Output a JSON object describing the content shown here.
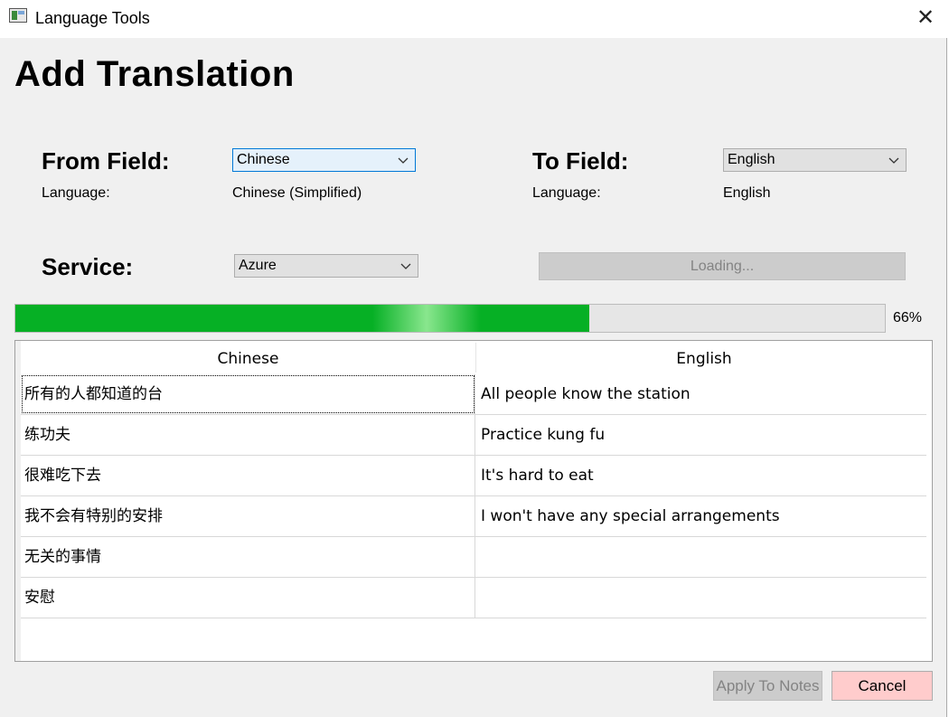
{
  "window": {
    "title": "Language Tools",
    "close_glyph": "✕"
  },
  "dialog": {
    "title": "Add Translation"
  },
  "from": {
    "label": "From Field:",
    "selected": "Chinese",
    "language_label": "Language:",
    "language_value": "Chinese (Simplified)"
  },
  "to": {
    "label": "To Field:",
    "selected": "English",
    "language_label": "Language:",
    "language_value": "English"
  },
  "service": {
    "label": "Service:",
    "selected": "Azure"
  },
  "loading_button": {
    "label": "Loading..."
  },
  "progress": {
    "percent": 66,
    "label": "66%",
    "accent_color": "#06b025"
  },
  "table": {
    "columns": [
      "Chinese",
      "English"
    ],
    "rows": [
      [
        "所有的人都知道的台",
        "All people know the station"
      ],
      [
        "练功夫",
        "Practice kung fu"
      ],
      [
        "很难吃下去",
        "It's hard to eat"
      ],
      [
        "我不会有特别的安排",
        "I won't have any special arrangements"
      ],
      [
        "无关的事情",
        ""
      ],
      [
        "安慰",
        ""
      ]
    ]
  },
  "buttons": {
    "apply": "Apply To Notes",
    "cancel": "Cancel"
  },
  "icons": {
    "app": "app-window-icon",
    "close": "close-icon",
    "dropdown": "chevron-down-icon"
  }
}
